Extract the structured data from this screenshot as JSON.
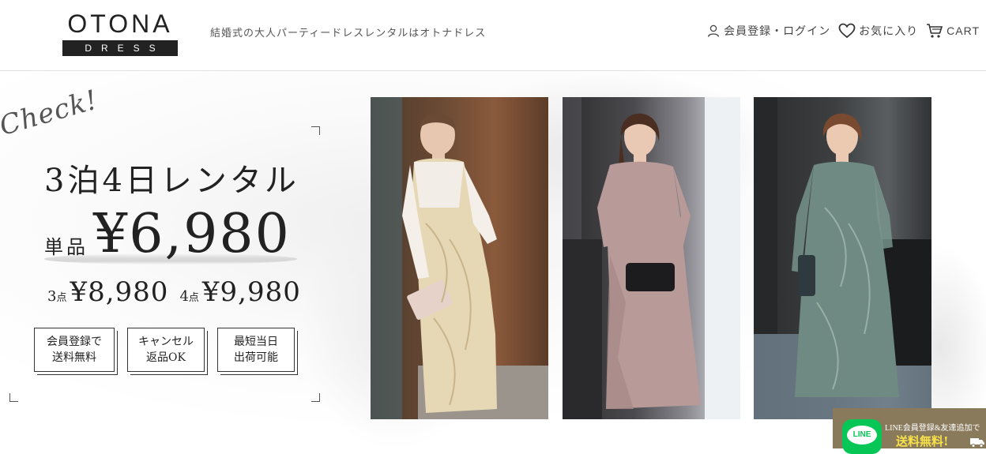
{
  "header": {
    "logo_main": "OTONA",
    "logo_sub": "DRESS",
    "tagline": "結婚式の大人パーティードレスレンタルはオトナドレス",
    "nav": {
      "login": "会員登録・ログイン",
      "favorites": "お気に入り",
      "cart": "CART"
    }
  },
  "hero": {
    "check": "Check!",
    "plan": "3泊4日レンタル",
    "price_label": "単品",
    "price_value": "¥6,980",
    "sub_prices": [
      {
        "count": "3",
        "unit": "点",
        "price": "¥8,980"
      },
      {
        "count": "4",
        "unit": "点",
        "price": "¥9,980"
      }
    ],
    "badges": [
      {
        "line1": "会員登録で",
        "line2": "送料無料"
      },
      {
        "line1": "キャンセル",
        "line2": "返品OK"
      },
      {
        "line1": "最短当日",
        "line2": "出荷可能"
      }
    ]
  },
  "line_banner": {
    "logo": "LINE",
    "text1": "LINE会員登録&友達追加で",
    "text2": "送料無料!"
  },
  "colors": {
    "text": "#222222",
    "line_green": "#06c755",
    "banner_bg": "#8a7a5c",
    "banner_highlight": "#f7e14a"
  }
}
